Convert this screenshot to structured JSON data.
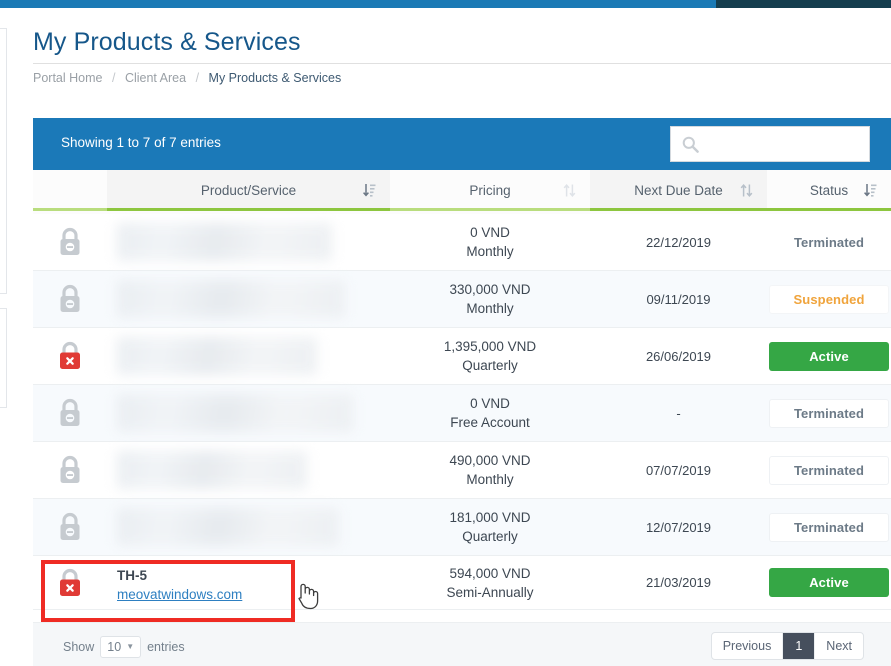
{
  "colors": {
    "topbar_blue": "#1b7ab5",
    "topbar_dark": "#153e4e",
    "panel_blue": "#1b79b8",
    "title_blue": "#16578a",
    "link_blue": "#2d7fc1",
    "sort_green": "#8dc63f",
    "active_green": "#35a745",
    "suspended_orange": "#f0a43c",
    "highlight_red": "#ef2b24",
    "lock_gray": "#c6cbd0",
    "lock_red": "#e03a35"
  },
  "header": {
    "page_title": "My Products & Services"
  },
  "breadcrumb": {
    "items": [
      {
        "label": "Portal Home",
        "current": false
      },
      {
        "label": "Client Area",
        "current": false
      },
      {
        "label": "My Products & Services",
        "current": true
      }
    ],
    "separator": "/"
  },
  "panel": {
    "showing_text": "Showing 1 to 7 of 7 entries",
    "search": {
      "value": "",
      "placeholder": "",
      "icon": "search-icon"
    }
  },
  "table": {
    "columns": [
      {
        "key": "icon",
        "label": "",
        "sort_icon": "",
        "shaded": false,
        "green": false
      },
      {
        "key": "prod",
        "label": "Product/Service",
        "sort_icon": "sort-amount-desc",
        "shaded": true,
        "green": true
      },
      {
        "key": "price",
        "label": "Pricing",
        "sort_icon": "sort-both",
        "shaded": false,
        "green": false
      },
      {
        "key": "due",
        "label": "Next Due Date",
        "sort_icon": "sort-both",
        "shaded": true,
        "green": true
      },
      {
        "key": "status",
        "label": "Status",
        "sort_icon": "sort-amount-desc",
        "shaded": false,
        "green": true
      }
    ],
    "rows": [
      {
        "lock": "lock-gray-minus",
        "product_name": "",
        "product_domain": "",
        "blurred": true,
        "price": "0 VND",
        "cycle": "Monthly",
        "next_due": "22/12/2019",
        "status": "Terminated",
        "status_kind": "terminated"
      },
      {
        "lock": "lock-gray-minus",
        "product_name": "",
        "product_domain": "",
        "blurred": true,
        "price": "330,000 VND",
        "cycle": "Monthly",
        "next_due": "09/11/2019",
        "status": "Suspended",
        "status_kind": "suspended"
      },
      {
        "lock": "lock-red-x",
        "product_name": "",
        "product_domain": "",
        "blurred": true,
        "price": "1,395,000 VND",
        "cycle": "Quarterly",
        "next_due": "26/06/2019",
        "status": "Active",
        "status_kind": "active"
      },
      {
        "lock": "lock-gray-minus",
        "product_name": "",
        "product_domain": "",
        "blurred": true,
        "price": "0 VND",
        "cycle": "Free Account",
        "next_due": "-",
        "status": "Terminated",
        "status_kind": "terminated"
      },
      {
        "lock": "lock-gray-minus",
        "product_name": "",
        "product_domain": "",
        "blurred": true,
        "price": "490,000 VND",
        "cycle": "Monthly",
        "next_due": "07/07/2019",
        "status": "Terminated",
        "status_kind": "terminated"
      },
      {
        "lock": "lock-gray-minus",
        "product_name": "",
        "product_domain": "",
        "blurred": true,
        "price": "181,000 VND",
        "cycle": "Quarterly",
        "next_due": "12/07/2019",
        "status": "Terminated",
        "status_kind": "terminated"
      },
      {
        "lock": "lock-red-x",
        "product_name": "TH-5",
        "product_domain": "meovatwindows.com",
        "blurred": false,
        "price": "594,000 VND",
        "cycle": "Semi-Annually",
        "next_due": "21/03/2019",
        "status": "Active",
        "status_kind": "active"
      }
    ]
  },
  "footer": {
    "show_label": "Show",
    "entries_label": "entries",
    "page_length": "10",
    "pagination": {
      "previous": "Previous",
      "pages": [
        "1"
      ],
      "next": "Next",
      "active_page": "1"
    }
  },
  "cursor": {
    "type": "pointer-hand-cursor"
  }
}
